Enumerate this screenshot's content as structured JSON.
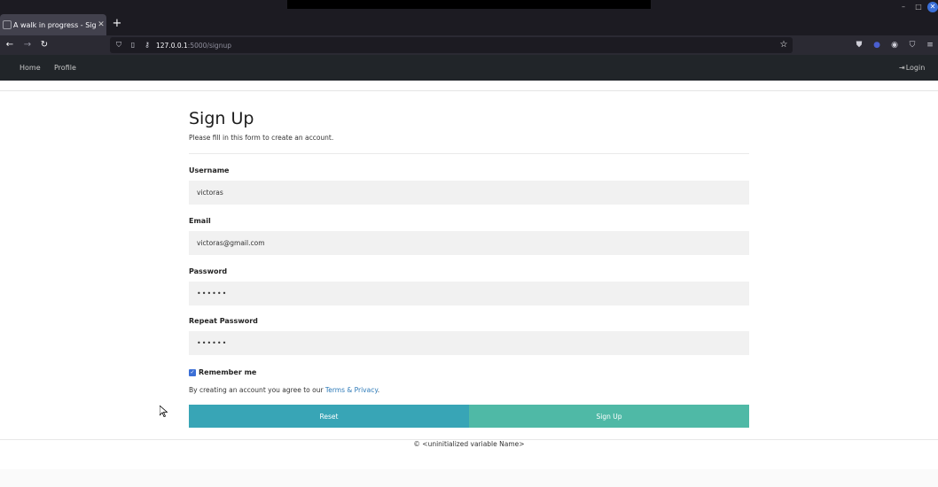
{
  "browser": {
    "tab_title": "A walk in progress - Signup",
    "tab_close": "✕",
    "new_tab": "+",
    "url_host": "127.0.0.1",
    "url_rest": ":5000/signup"
  },
  "nav": {
    "home": "Home",
    "profile": "Profile",
    "login": "Login"
  },
  "form": {
    "title": "Sign Up",
    "subtitle": "Please fill in this form to create an account.",
    "username_label": "Username",
    "username_value": "victoras",
    "email_label": "Email",
    "email_value": "victoras@gmail.com",
    "password_label": "Password",
    "password_value": "••••••",
    "repeat_label": "Repeat Password",
    "repeat_value": "••••••",
    "remember_label": "Remember me",
    "remember_checked": true,
    "agree_prefix": "By creating an account you agree to our ",
    "agree_link": "Terms & Privacy",
    "agree_suffix": ".",
    "reset_label": "Reset",
    "signup_label": "Sign Up"
  },
  "footer": {
    "text": "© <uninitialized variable Name>"
  },
  "colors": {
    "reset_button": "#38a5b6",
    "signup_button": "#4fb9a6",
    "navbar": "#212529",
    "link": "#2d7ab8"
  }
}
